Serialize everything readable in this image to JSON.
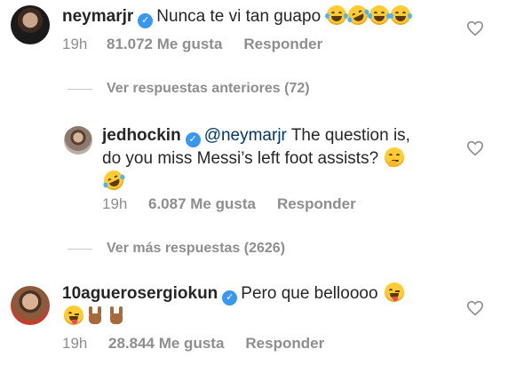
{
  "comments": [
    {
      "username": "neymarjr",
      "verified": true,
      "text": "Nunca te vi tan guapo",
      "emojis": [
        "joy",
        "rofl",
        "joy",
        "joy"
      ],
      "time": "19h",
      "likes": "81.072 Me gusta",
      "reply_label": "Responder"
    },
    {
      "username": "jedhockin",
      "verified": true,
      "mention": "@neymarjr",
      "text_line1": "The question is,",
      "text_line2": "do you miss Messi’s left foot assists?",
      "emojis": [
        "thinking",
        "rofl"
      ],
      "time": "19h",
      "likes": "6.087 Me gusta",
      "reply_label": "Responder"
    },
    {
      "username": "10aguerosergiokun",
      "verified": true,
      "text": "Pero que belloooo",
      "emojis": [
        "winking-tongue",
        "winking-tongue",
        "sign-of-horns",
        "sign-of-horns"
      ],
      "time": "19h",
      "likes": "28.844 Me gusta",
      "reply_label": "Responder"
    }
  ],
  "thread_links": {
    "previous": "Ver respuestas anteriores (72)",
    "more": "Ver más respuestas (2626)"
  },
  "icons": {
    "verified": "verified-badge-icon",
    "like": "heart-outline-icon"
  },
  "colors": {
    "text": "#262626",
    "meta": "#8e8e8e",
    "verified": "#3897f0",
    "mention": "#00376b"
  }
}
